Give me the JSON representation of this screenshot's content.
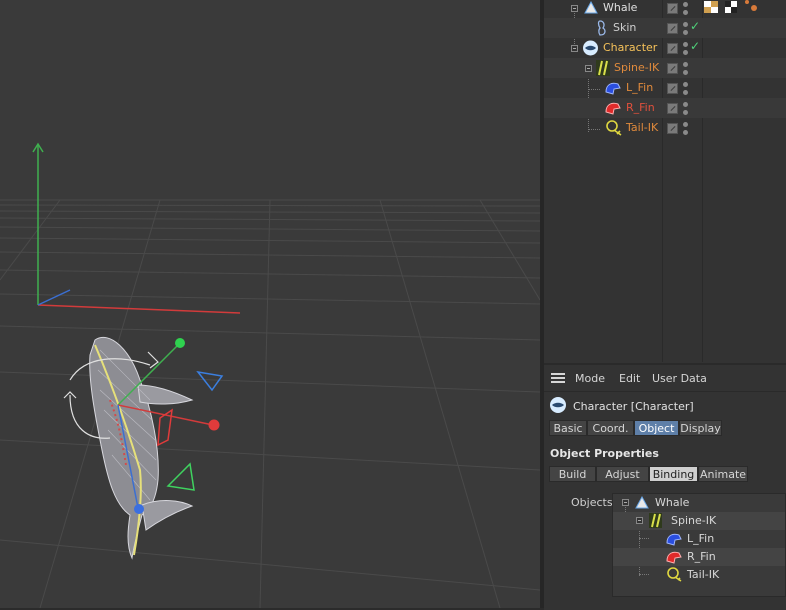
{
  "object_manager": {
    "rows": [
      {
        "name": "Whale",
        "color": "#e0e0e0",
        "icon": "polygon-object-icon"
      },
      {
        "name": "Skin",
        "color": "#d0d0d0",
        "icon": "skin-deformer-icon"
      },
      {
        "name": "Character",
        "color": "#f6c25a",
        "icon": "character-object-icon"
      },
      {
        "name": "Spine-IK",
        "color": "#e08a3c",
        "icon": "spine-ik-icon"
      },
      {
        "name": "L_Fin",
        "color": "#e08a3c",
        "icon": "left-fin-joint-icon"
      },
      {
        "name": "R_Fin",
        "color": "#e08a3c",
        "icon": "right-fin-joint-icon"
      },
      {
        "name": "Tail-IK",
        "color": "#e08a3c",
        "icon": "tail-ik-icon"
      }
    ],
    "check_glyph": "✓"
  },
  "attributes": {
    "menu": {
      "mode": "Mode",
      "edit": "Edit",
      "user_data": "User Data"
    },
    "object_title": "Character [Character]",
    "main_tabs": [
      "Basic",
      "Coord.",
      "Object",
      "Display"
    ],
    "section_title": "Object Properties",
    "sub_tabs": [
      "Build",
      "Adjust",
      "Binding",
      "Animate"
    ],
    "objects_label": "Objects",
    "objects_list": [
      "Whale",
      "Spine-IK",
      "L_Fin",
      "R_Fin",
      "Tail-IK"
    ]
  },
  "colors": {
    "accent_tab": "#5e7fa8",
    "active_object": "#f6c25a",
    "joint_object": "#e08a3c",
    "enabled_check": "#4fd27a"
  }
}
